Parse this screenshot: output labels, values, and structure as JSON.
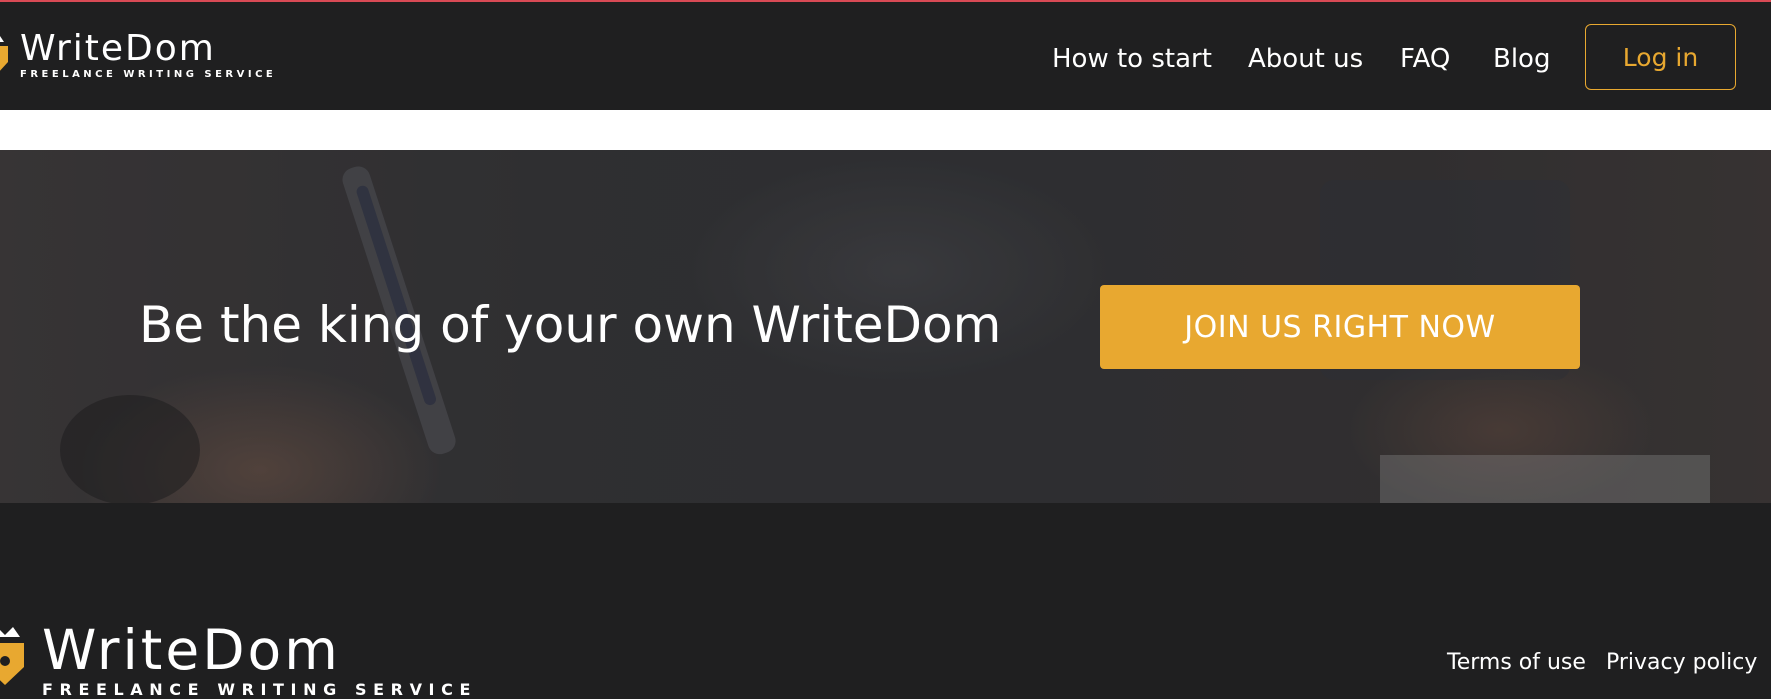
{
  "header": {
    "logo": {
      "name": "WriteDom",
      "tagline": "FREELANCE WRITING SERVICE"
    },
    "nav": [
      {
        "label": "How to start"
      },
      {
        "label": "About us"
      },
      {
        "label": "FAQ"
      },
      {
        "label": "Blog"
      }
    ],
    "login_label": "Log in"
  },
  "hero": {
    "title": "Be the king of your own WriteDom",
    "cta_label": "JOIN US RIGHT NOW"
  },
  "footer": {
    "logo": {
      "name": "WriteDom",
      "tagline": "FREELANCE WRITING SERVICE"
    },
    "links": [
      {
        "label": "Terms of use"
      },
      {
        "label": "Privacy policy"
      }
    ]
  },
  "colors": {
    "accent": "#e8a830",
    "dark_bg": "#1f1f20",
    "top_border": "#d94a55"
  },
  "icons": {
    "logo_mark": "crowned-pen-nib-icon"
  }
}
